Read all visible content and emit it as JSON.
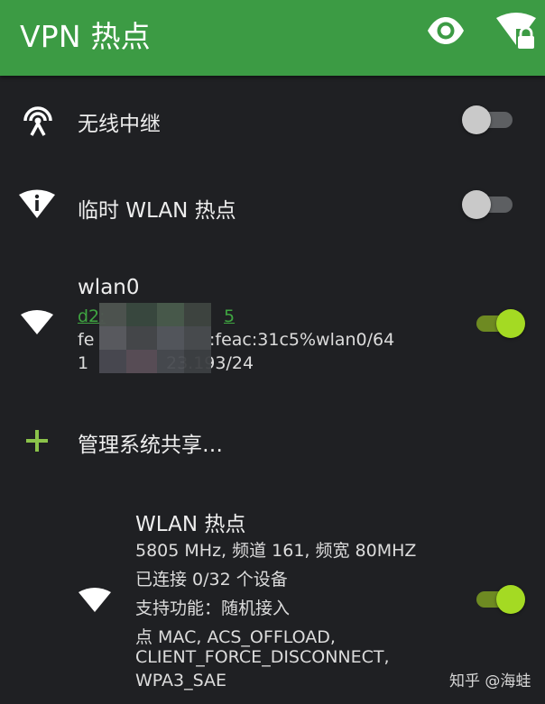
{
  "app_bar": {
    "title": "VPN 热点",
    "actions": [
      "eye-icon",
      "wifi-lock-icon"
    ],
    "color": "#3c9b44"
  },
  "rows": {
    "repeater": {
      "label": "无线中继",
      "enabled": false,
      "icon": "repeater-antenna-icon"
    },
    "temp_hotspot": {
      "label": "临时 WLAN 热点",
      "enabled": false,
      "icon": "wifi-info-icon"
    },
    "wlan0": {
      "label": "wlan0",
      "mac": "d2:",
      "mac_tail": "5",
      "ipv6_prefix": "fe",
      "ipv6_tail": ":feac:31c5%wlan0/64",
      "ipv4_prefix": "1",
      "ipv4_tail": "23.193/24",
      "enabled": true,
      "icon": "wifi-icon"
    },
    "manage": {
      "label": "管理系统共享…",
      "icon": "plus-icon"
    },
    "wlan_hotspot": {
      "label": "WLAN 热点",
      "details": [
        "5805 MHz, 频道 161, 频宽 80MHZ",
        "已连接 0/32 个设备",
        "支持功能：随机接入",
        "点 MAC, ACS_OFFLOAD,",
        "CLIENT_FORCE_DISCONNECT,",
        "WPA3_SAE"
      ],
      "enabled": true,
      "icon": "wifi-icon"
    }
  },
  "colors": {
    "accent_green": "#a4da23",
    "link_green": "#3fa541",
    "background": "#1f2023"
  },
  "watermark": "知乎 @海蛙"
}
